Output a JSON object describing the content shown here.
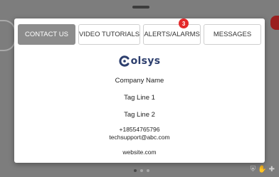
{
  "tabs": [
    {
      "label": "CONTACT US",
      "active": true
    },
    {
      "label": "VIDEO TUTORIALS",
      "active": false
    },
    {
      "label": "ALERTS/ALARMS",
      "active": false,
      "badge": "3"
    },
    {
      "label": "MESSAGES",
      "active": false
    }
  ],
  "logo": {
    "text": "olsys",
    "icon": "colsys-c-logo-icon"
  },
  "contact": {
    "company_name": "Company Name",
    "tag_line_1": "Tag Line 1",
    "tag_line_2": "Tag Line 2",
    "phone": "+18554765796",
    "email": "techsupport@abc.com",
    "website": "website.com"
  },
  "background": {
    "page_dots": 3,
    "active_dot": 1
  },
  "colors": {
    "active_tab": "#8c8c8c",
    "badge": "#e4292a",
    "logo": "#2d3f6e",
    "overlay": "#7d7d7d"
  }
}
